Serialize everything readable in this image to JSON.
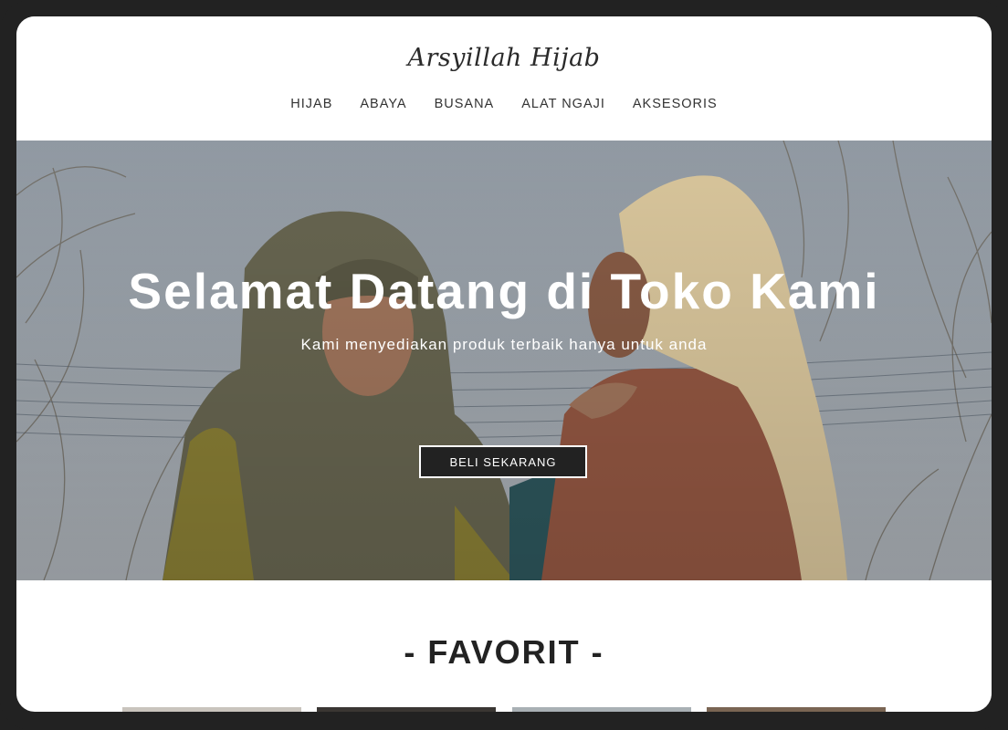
{
  "brand": {
    "logo_text": "Arsyillah Hijab"
  },
  "nav": {
    "items": [
      {
        "label": "HIJAB"
      },
      {
        "label": "ABAYA"
      },
      {
        "label": "BUSANA"
      },
      {
        "label": "ALAT NGAJI"
      },
      {
        "label": "AKSESORIS"
      }
    ]
  },
  "hero": {
    "title": "Selamat Datang di Toko Kami",
    "subtitle": "Kami menyediakan produk terbaik hanya untuk anda",
    "cta_label": "BELI SEKARANG"
  },
  "favorites": {
    "title": "- FAVORIT -"
  },
  "colors": {
    "frame": "#222222",
    "header_bg": "#ffffff",
    "button_bg": "#222222",
    "text_dark": "#222222"
  }
}
